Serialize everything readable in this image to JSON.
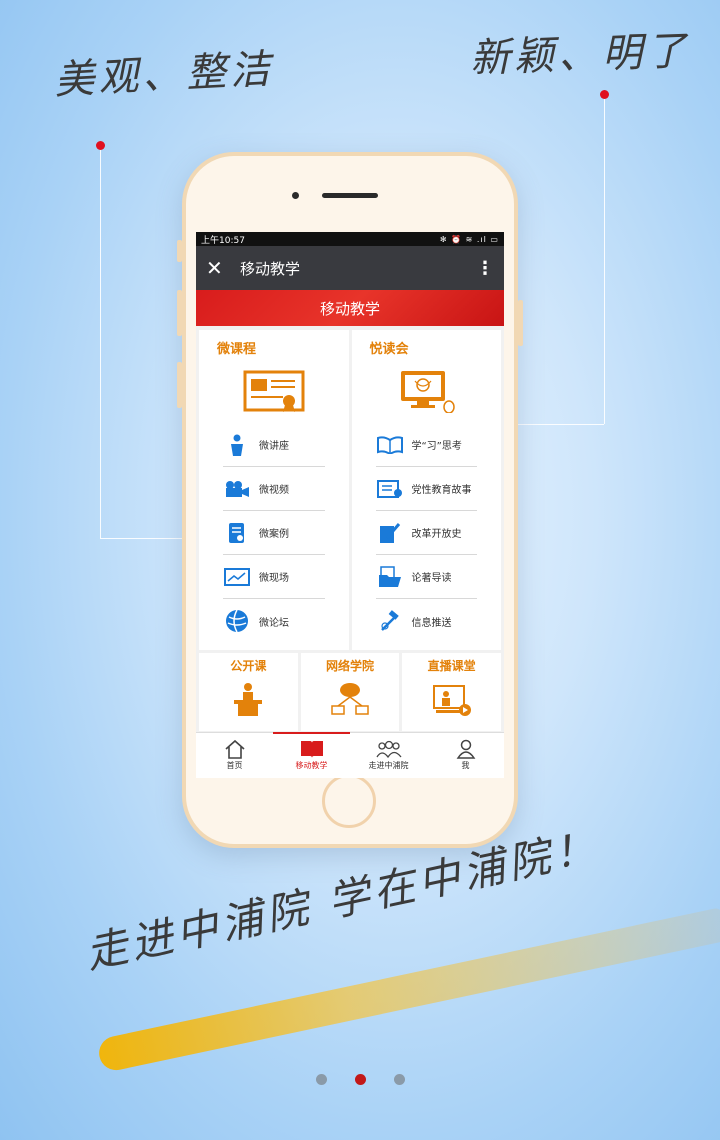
{
  "headline_left": "美观、整洁",
  "headline_right": "新颖、明了",
  "slogan": "走进中浦院 学在中浦院！",
  "status_bar": {
    "time": "上午10:57",
    "icons": "✻ ⏰ ≋ .ıl ▭"
  },
  "titlebar": {
    "close_icon": "close-icon",
    "title": "移动教学",
    "more_icon": "more-vertical-icon"
  },
  "banner": {
    "title": "移动教学"
  },
  "left_card": {
    "heading": "微课程",
    "items": [
      {
        "label": "微讲座",
        "icon": "lecturer-icon"
      },
      {
        "label": "微视频",
        "icon": "video-camera-icon"
      },
      {
        "label": "微案例",
        "icon": "case-document-icon"
      },
      {
        "label": "微现场",
        "icon": "board-icon"
      },
      {
        "label": "微论坛",
        "icon": "globe-icon"
      }
    ]
  },
  "right_card": {
    "heading": "悦读会",
    "items": [
      {
        "label": "学“习”思考",
        "icon": "open-book-icon"
      },
      {
        "label": "党性教育故事",
        "icon": "story-book-icon"
      },
      {
        "label": "改革开放史",
        "icon": "pen-notebook-icon"
      },
      {
        "label": "论著导读",
        "icon": "folder-document-icon"
      },
      {
        "label": "信息推送",
        "icon": "satellite-icon"
      }
    ]
  },
  "bottom_cards": [
    {
      "heading": "公开课",
      "icon": "podium-icon"
    },
    {
      "heading": "网络学院",
      "icon": "network-cloud-icon"
    },
    {
      "heading": "直播课堂",
      "icon": "live-class-icon"
    }
  ],
  "tabbar": [
    {
      "label": "首页",
      "icon": "home-icon"
    },
    {
      "label": "移动教学",
      "icon": "book-icon",
      "active": true
    },
    {
      "label": "走进中浦院",
      "icon": "group-icon"
    },
    {
      "label": "我",
      "icon": "user-icon"
    }
  ],
  "pager": {
    "pages": 3,
    "current": 2
  },
  "colors": {
    "accent_red": "#d81c1c",
    "accent_orange": "#e3820b",
    "icon_blue": "#1a7ad8",
    "titlebar": "#393a3f"
  }
}
